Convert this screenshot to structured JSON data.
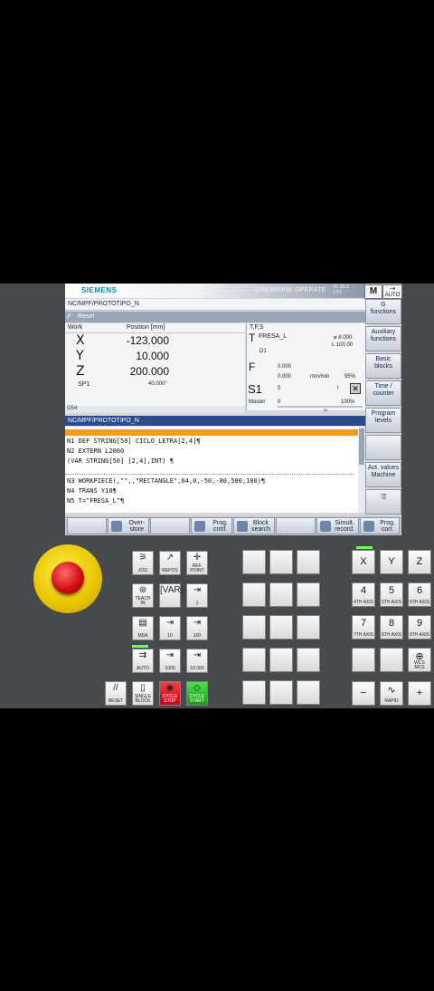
{
  "screen": {
    "brand": "SIEMENS",
    "product": "SINUMERIK OPERATE",
    "clock_line1": "TE 25.3",
    "clock_line2": "1:51",
    "mode_m": "M",
    "mode_auto": "AUTO",
    "path": "NC/MPF/PROTOTIPO_N",
    "channel_state": "Reset",
    "work_label": "Work",
    "position_header": "Position [mm]",
    "axes": [
      {
        "name": "X",
        "value": "-123.000"
      },
      {
        "name": "Y",
        "value": "10.000"
      },
      {
        "name": "Z",
        "value": "200.000"
      }
    ],
    "spindle": {
      "name": "SP1",
      "value": "40.000°"
    },
    "work_offset": "G54",
    "tfs": {
      "header": "T,F,S",
      "t_label": "T",
      "tool": "FRESA_L",
      "diameter": "⌀ 8.000",
      "length": "L 100.00",
      "edge": "D1",
      "f_label": "F",
      "feed_act": "0.000",
      "feed_set": "0.000",
      "feed_unit": "mm/min",
      "feed_override": "95%",
      "s_label": "S1",
      "s_act": "0",
      "s_dir": "I",
      "master_label": "Master",
      "master_val": "0",
      "s_override": "100%",
      "s_scale": "50"
    },
    "program_title": "NC/MPF/PROTOTIPO_N",
    "code_lines": [
      "N1 DEF STRING[50] CICLO_LETRA[2,4]¶",
      "N2 EXTERN L2000",
      "(VAR STRING[50] [2,4],INT) ¶",
      "N3 WORKPIECE(,\"\",,\"RECTANGLE\",64,0,-50,-80,500,100)¶",
      "N4 TRANS Y10¶",
      "N5 T=\"FRESA_L\"¶"
    ],
    "vertical_softkeys": [
      "G\nfunctions",
      "Auxiliary\nfunctions",
      "Basic\nblocks",
      "Time /\ncounter",
      "Program\nlevels",
      "",
      "Act. values\nMachine",
      ""
    ],
    "horizontal_softkeys": [
      "",
      "Over-\nstore",
      "",
      "Prog.\ncntrl.",
      "Block\nsearch",
      "",
      "Simult.\nrecord.",
      "Prog.\ncorr."
    ]
  },
  "machine_panel": {
    "mode_keys": [
      {
        "symbol": "⚞",
        "label": "JOG"
      },
      {
        "symbol": "↗",
        "label": "REPOS"
      },
      {
        "symbol": "✛",
        "label": "REF. POINT"
      },
      {
        "symbol": "⊛",
        "label": "TEACH IN"
      },
      {
        "symbol": "[VAR]",
        "label": ""
      },
      {
        "symbol": "⇥",
        "label": "1"
      },
      {
        "symbol": "▤",
        "label": "MDA"
      },
      {
        "symbol": "⇥",
        "label": "10"
      },
      {
        "symbol": "⇥",
        "label": "100"
      },
      {
        "symbol": "⇉",
        "label": "AUTO"
      },
      {
        "symbol": "⇥",
        "label": "1000"
      },
      {
        "symbol": "⇥",
        "label": "10 000"
      },
      {
        "symbol": "//",
        "label": "RESET"
      },
      {
        "symbol": "▯",
        "label": "SINGLE BLOCK"
      },
      {
        "symbol": "◉",
        "label": "CYCLE STOP"
      },
      {
        "symbol": "◇",
        "label": "CYCLE START"
      }
    ],
    "axis_keys": [
      {
        "symbol": "X",
        "label": ""
      },
      {
        "symbol": "Y",
        "label": ""
      },
      {
        "symbol": "Z",
        "label": ""
      },
      {
        "symbol": "4",
        "label": "4TH AXIS"
      },
      {
        "symbol": "5",
        "label": "5TH AXIS"
      },
      {
        "symbol": "6",
        "label": "6TH AXIS"
      },
      {
        "symbol": "7",
        "label": "7TH AXIS"
      },
      {
        "symbol": "8",
        "label": "8TH AXIS"
      },
      {
        "symbol": "9",
        "label": "9TH AXIS"
      },
      {
        "symbol": "⊕",
        "label": "WCS MCS"
      },
      {
        "symbol": "−",
        "label": ""
      },
      {
        "symbol": "∿",
        "label": "RAPID"
      },
      {
        "symbol": "+",
        "label": ""
      }
    ]
  },
  "colors": {
    "header_blue": "#2b4c8c",
    "highlight": "#f39a24",
    "estop_red": "#d40f16",
    "estop_yellow": "#e8c400"
  }
}
